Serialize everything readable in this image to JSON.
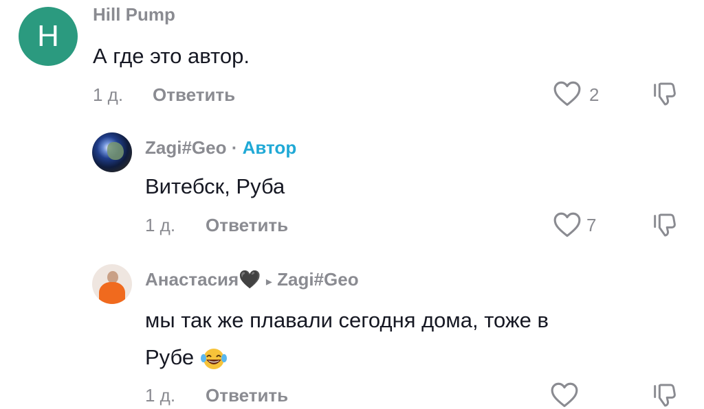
{
  "comments": [
    {
      "avatar_letter": "H",
      "username": "Hill Pump",
      "text": "А где это автор.",
      "time": "1 д.",
      "reply_label": "Ответить",
      "likes": "2"
    },
    {
      "username": "Zagi#Geo",
      "separator": "·",
      "author_badge": "Автор",
      "text": "Витебск, Руба",
      "time": "1 д.",
      "reply_label": "Ответить",
      "likes": "7"
    },
    {
      "username": "Анастасия🖤",
      "reply_arrow": "▸",
      "reply_to": "Zagi#Geo",
      "text_line1": "мы так же плавали сегодня дома, тоже в",
      "text_line2": "Рубе",
      "emoji": "laughing-face-emoji",
      "time": "1 д.",
      "reply_label": "Ответить"
    }
  ],
  "colors": {
    "avatar_bg": "#2b9a7f",
    "author_badge": "#20a9d6",
    "muted_text": "#8a8b91",
    "primary_text": "#161823"
  }
}
